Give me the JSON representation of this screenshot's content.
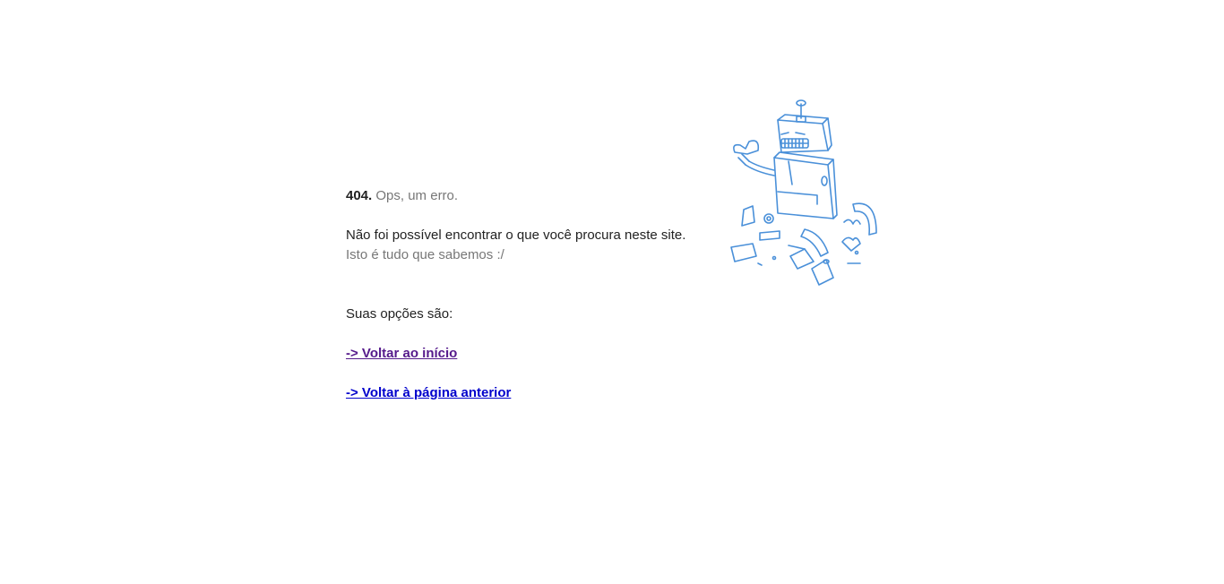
{
  "error": {
    "code": "404.",
    "title": "Ops, um erro."
  },
  "message": {
    "line1": "Não foi possível encontrar o que você procura neste site.",
    "line2": "Isto é tudo que sabemos :/"
  },
  "options": {
    "heading": "Suas opções são:",
    "home_link": "-> Voltar ao início",
    "back_link": "-> Voltar à página anterior"
  },
  "illustration": {
    "icon": "broken-robot-icon",
    "stroke_color": "#4a90d9"
  },
  "colors": {
    "text": "#222222",
    "muted": "#777777",
    "visited_link": "#551a8b",
    "link": "#0000cc"
  }
}
